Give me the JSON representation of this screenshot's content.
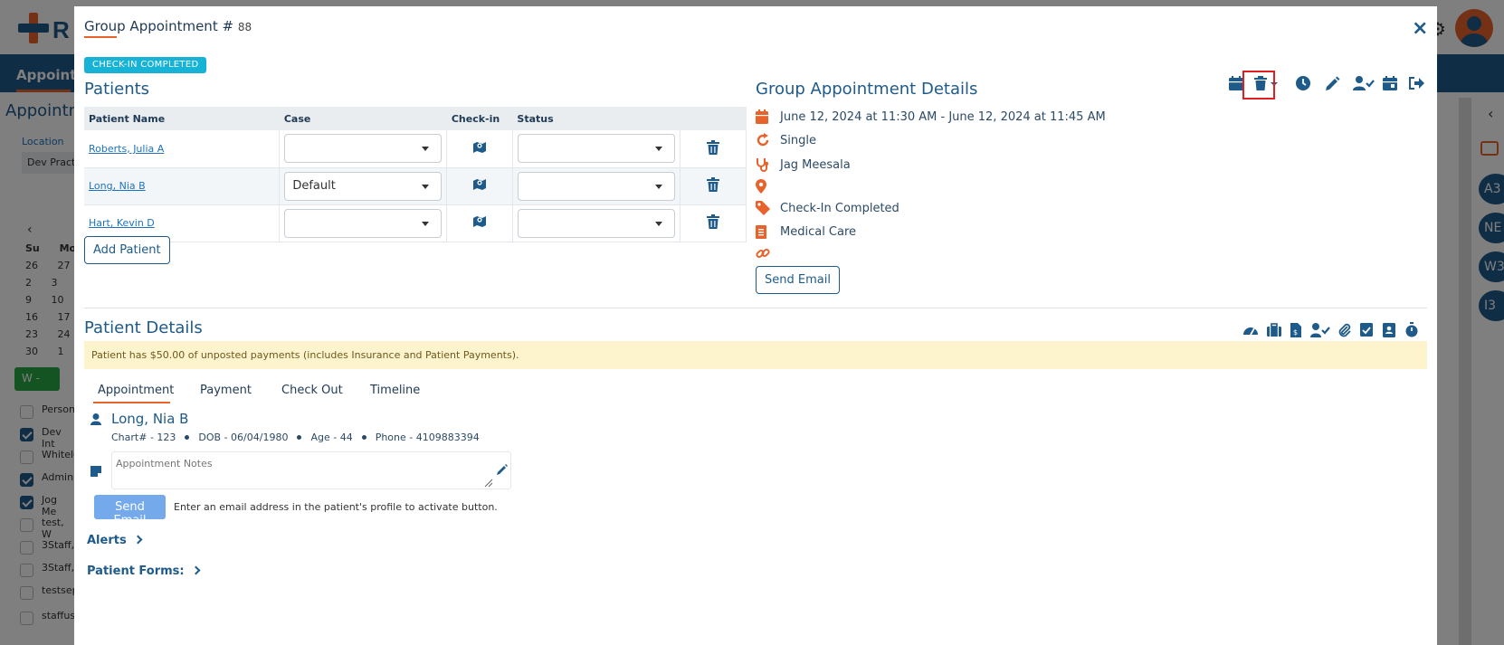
{
  "background": {
    "logo_text": "R",
    "nav_label": "Appoint",
    "page_title": "Appointm",
    "location_label": "Location",
    "location_value": "Dev Practi",
    "calendar_days_header": "Su Mo",
    "calendar_rows": [
      "26 27",
      "2 3",
      "9 10",
      "16 17",
      "23 24",
      "30 1"
    ],
    "w_button": "W -",
    "list_items": [
      "Person",
      "Dev Int",
      "Whitele",
      "Admin,",
      "Jog Me",
      "test, W",
      "3Staff,",
      "3Staff,",
      "testsep",
      "staffuse"
    ],
    "rail_badges": [
      "A3",
      "NE",
      "W3",
      "I3"
    ]
  },
  "modal": {
    "title": "Group Appointment #",
    "number": "88",
    "close_label": "×",
    "status_badge": "CHECK-IN COMPLETED"
  },
  "patients": {
    "title": "Patients",
    "columns": [
      "Patient Name",
      "Case",
      "Check-in",
      "Status"
    ],
    "rows": [
      {
        "name": "Roberts, Julia A",
        "case": "",
        "status": ""
      },
      {
        "name": "Long, Nia B",
        "case": "Default",
        "status": ""
      },
      {
        "name": "Hart, Kevin D",
        "case": "",
        "status": ""
      }
    ],
    "add_button": "Add Patient"
  },
  "group_details": {
    "title": "Group Appointment Details",
    "datetime": "June 12, 2024 at 11:30 AM - June 12, 2024 at 11:45 AM",
    "recurrence": "Single",
    "provider": "Jag Meesala",
    "location": "",
    "status": "Check-In Completed",
    "type": "Medical Care",
    "link": "",
    "send_email": "Send Email"
  },
  "patient_details": {
    "title": "Patient Details",
    "alert": "Patient has $50.00 of unposted payments (includes Insurance and Patient Payments).",
    "tabs": [
      "Appointment",
      "Payment",
      "Check Out",
      "Timeline"
    ],
    "active_tab": "Appointment",
    "patient_name": "Long, Nia B",
    "chart": "Chart# - 123",
    "dob": "DOB - 06/04/1980",
    "age": "Age - 44",
    "phone": "Phone - 4109883394",
    "notes_placeholder": "Appointment Notes",
    "send_email": "Send Email",
    "send_hint": "Enter an email address in the patient's profile to activate button.",
    "alerts_label": "Alerts",
    "forms_label": "Patient Forms:"
  },
  "colors": {
    "primary": "#1e5a8a",
    "accent": "#e8632b",
    "badge": "#17b3d6",
    "alert_bg": "#fdf3cd",
    "highlight": "#e02020"
  }
}
